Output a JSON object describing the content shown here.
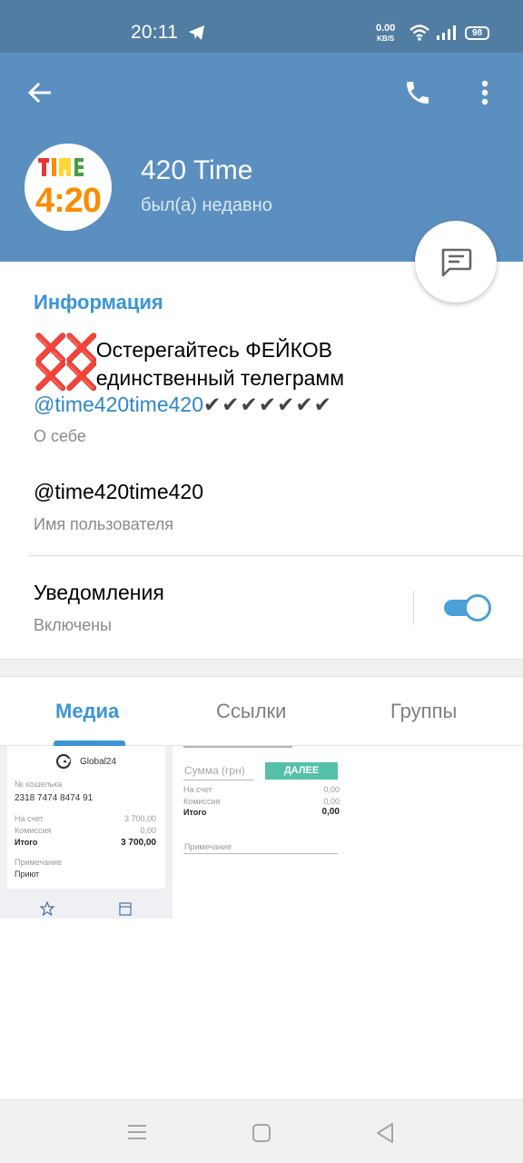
{
  "statusbar": {
    "time": "20:11",
    "speed_value": "0.00",
    "speed_unit": "KB/S",
    "battery": "98"
  },
  "profile": {
    "name": "420 Time",
    "status": "был(а) недавно",
    "logo_top": "TIME",
    "logo_bottom": "4:20"
  },
  "info": {
    "section_title": "Информация",
    "about_line1": "Остерегайтесь ФЕЙКОВ",
    "about_line2": "единственный телеграмм",
    "about_link": "@time420time420",
    "about_checks": "✔✔✔✔✔✔✔",
    "about_mark": "❌❌",
    "about_label": "О себе",
    "username": "@time420time420",
    "username_label": "Имя пользователя",
    "notifications": "Уведомления",
    "notifications_status": "Включены"
  },
  "tabs": [
    {
      "label": "Медиа",
      "active": true
    },
    {
      "label": "Ссылки",
      "active": false
    },
    {
      "label": "Группы",
      "active": false
    }
  ],
  "media": {
    "thumb1": {
      "brand": "Global24",
      "wallet_label": "№ кошелька",
      "wallet": "2318 7474 8474 91",
      "to_account_label": "На счет",
      "to_account": "3 700,00",
      "commission_label": "Комиссия",
      "commission": "0,00",
      "total_label": "Итого",
      "total": "3 700,00",
      "note_label": "Примечание",
      "note": "Приют"
    },
    "thumb2": {
      "amount_placeholder": "Сумма (грн)",
      "next_button": "ДАЛЕЕ",
      "to_account_label": "На счет",
      "to_account": "0,00",
      "commission_label": "Комиссия",
      "commission": "0,00",
      "total_label": "Итого",
      "total": "0,00",
      "note_label": "Примечание"
    }
  },
  "colors": {
    "statusbar": "#527da3",
    "header": "#5b8fbf",
    "accent": "#3a95d5",
    "toggle": "#4ca0d9"
  }
}
